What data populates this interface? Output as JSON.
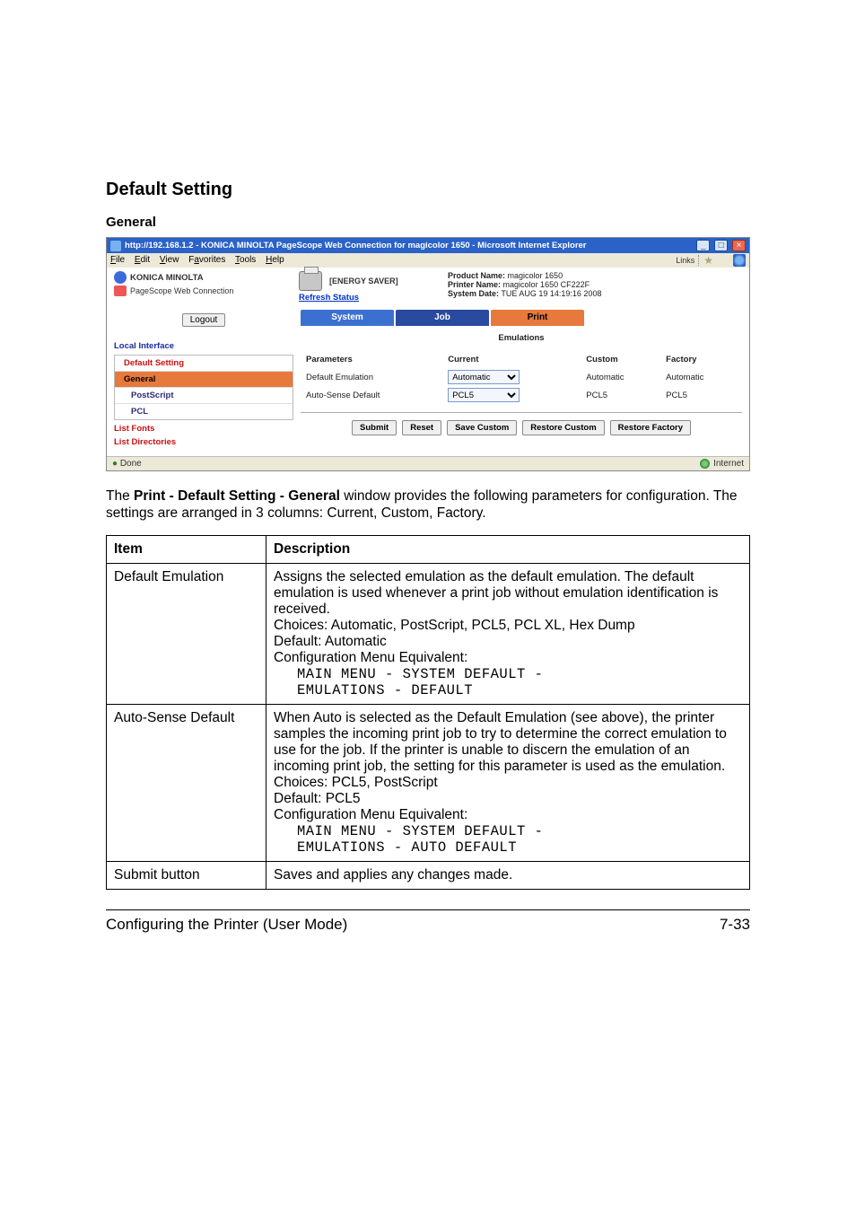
{
  "headings": {
    "h2": "Default Setting",
    "h3": "General"
  },
  "browser": {
    "title": "http://192.168.1.2 - KONICA MINOLTA PageScope Web Connection for magicolor 1650 - Microsoft Internet Explorer",
    "win_min": "_",
    "win_max": "□",
    "win_close": "×",
    "menus": {
      "file": "File",
      "edit": "Edit",
      "view": "View",
      "favorites": "Favorites",
      "tools": "Tools",
      "help": "Help"
    },
    "links_label": "Links",
    "brand": "KONICA MINOLTA",
    "pagescope": "PageScope Web Connection",
    "energy": "[ENERGY SAVER]",
    "refresh": "Refresh Status",
    "product_name_label": "Product Name:",
    "product_name": "magicolor 1650",
    "printer_name_label": "Printer Name:",
    "printer_name": "magicolor 1650 CF222F",
    "system_date_label": "System Date:",
    "system_date": "TUE AUG 19 14:19:16 2008",
    "logout": "Logout",
    "tabs": {
      "system": "System",
      "job": "Job",
      "print": "Print"
    },
    "emulations_hdr": "Emulations",
    "side": {
      "local_interface": "Local Interface",
      "default_setting": "Default Setting",
      "general": "General",
      "postscript": "PostScript",
      "pcl": "PCL",
      "list_fonts": "List Fonts",
      "list_directories": "List Directories"
    },
    "param_headers": {
      "params": "Parameters",
      "current": "Current",
      "custom": "Custom",
      "factory": "Factory"
    },
    "rows": {
      "r1p": "Default Emulation",
      "r1cur": "Automatic",
      "r1cus": "Automatic",
      "r1fac": "Automatic",
      "r2p": "Auto-Sense Default",
      "r2cur": "PCL5",
      "r2cus": "PCL5",
      "r2fac": "PCL5"
    },
    "actions": {
      "submit": "Submit",
      "reset": "Reset",
      "save_custom": "Save Custom",
      "restore_custom": "Restore Custom",
      "restore_factory": "Restore Factory"
    },
    "status_done": "Done",
    "status_zone": "Internet"
  },
  "intro": {
    "pre": "The ",
    "bold": "Print - Default Setting - General",
    "post": " window provides the following parameters for configuration. The settings are arranged in 3 columns: Current, Custom, Factory."
  },
  "desc_table": {
    "th_item": "Item",
    "th_desc": "Description",
    "r1_item": "Default Emulation",
    "r1_p1": "Assigns the selected emulation as the default emulation. The default emulation is used whenever a print job without emulation identification is received.",
    "r1_p2": "Choices: Automatic, PostScript, PCL5, PCL XL, Hex Dump",
    "r1_p3": "Default: Automatic",
    "r1_p4": "Configuration Menu Equivalent:",
    "r1_m1": "MAIN MENU - SYSTEM DEFAULT -",
    "r1_m2": "EMULATIONS - DEFAULT",
    "r2_item": "Auto-Sense Default",
    "r2_p1": "When Auto is selected as the Default Emulation (see above), the printer samples the incoming print job to try to determine the correct emulation to use for the job. If the printer is unable to discern the emulation of an incoming print job, the setting for this parameter is used as the emulation.",
    "r2_p2": "Choices: PCL5, PostScript",
    "r2_p3": "Default: PCL5",
    "r2_p4": "Configuration Menu Equivalent:",
    "r2_m1": "MAIN MENU - SYSTEM DEFAULT -",
    "r2_m2": "EMULATIONS - AUTO DEFAULT",
    "r3_item": "Submit button",
    "r3_desc": "Saves and applies any changes made."
  },
  "footer": {
    "left": "Configuring the Printer (User Mode)",
    "right": "7-33"
  }
}
